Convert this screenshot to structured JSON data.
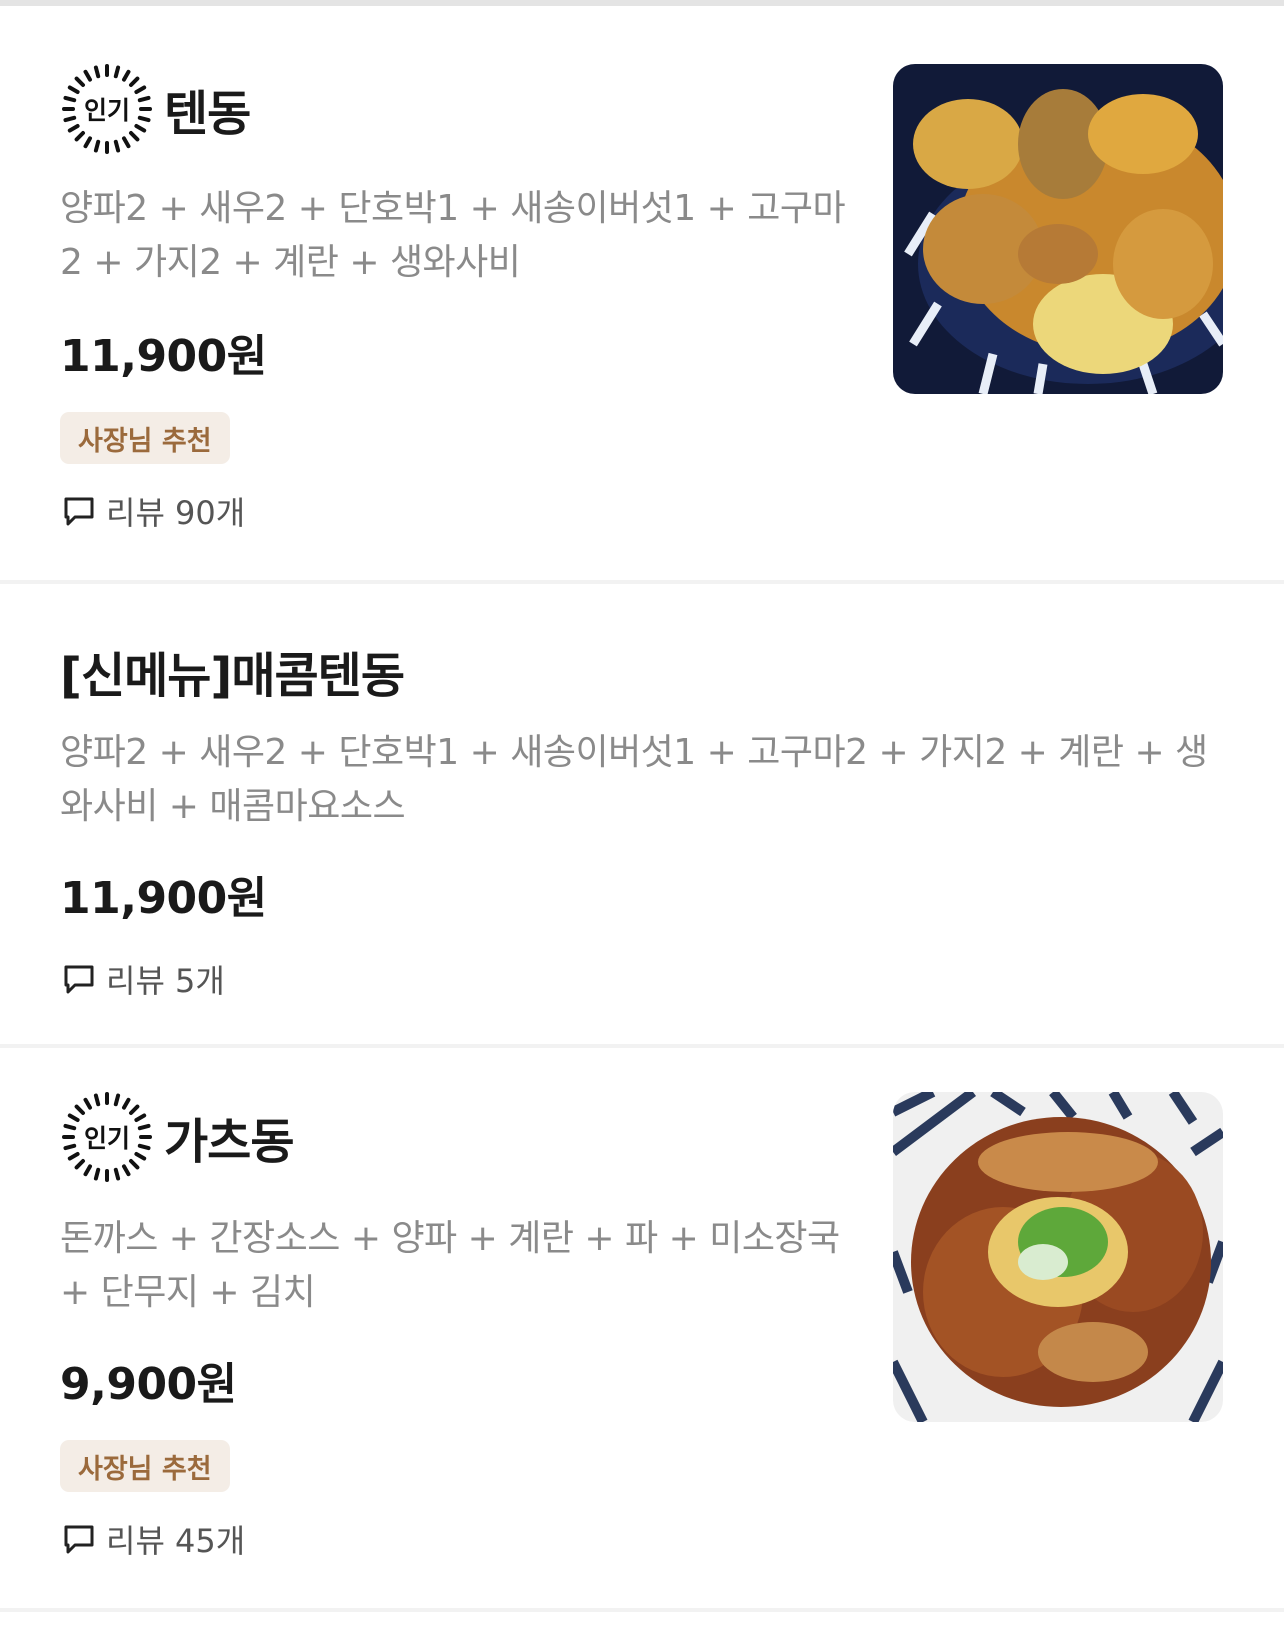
{
  "menu": {
    "popular_badge": "인기",
    "recommend_badge": "사장님 추천",
    "items": [
      {
        "name": "텐동",
        "description": "양파2 + 새우2 + 단호박1 + 새송이버섯1 + 고구마2 + 가지2 + 계란 + 생와사비",
        "price": "11,900원",
        "reviews": "리뷰 90개",
        "image_icon": "tendon-food-photo"
      },
      {
        "name": "[신메뉴]매콤텐동",
        "description": "양파2 + 새우2 + 단호박1 + 새송이버섯1 + 고구마2 + 가지2 + 계란 + 생와사비 + 매콤마요소스",
        "price": "11,900원",
        "reviews": "리뷰 5개"
      },
      {
        "name": "가츠동",
        "description": "돈까스 + 간장소스 + 양파 + 계란 + 파 + 미소장국 + 단무지 + 김치",
        "price": "9,900원",
        "reviews": "리뷰 45개",
        "image_icon": "katsudon-food-photo"
      }
    ]
  },
  "colors": {
    "recommend_bg": "#f4ede6",
    "recommend_text": "#9b6a3c",
    "description": "#8a8a8a"
  }
}
